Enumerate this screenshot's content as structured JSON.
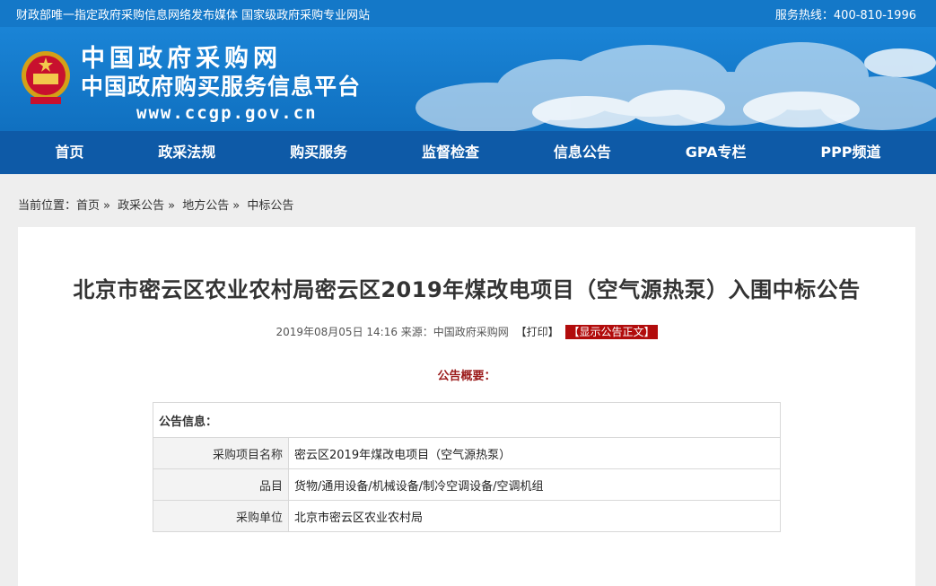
{
  "topbar": {
    "left_text": "财政部唯一指定政府采购信息网络发布媒体 国家级政府采购专业网站",
    "hotline_label": "服务热线：",
    "hotline": "400-810-1996"
  },
  "header": {
    "site_name": "中国政府采购网",
    "site_subtitle": "中国政府购买服务信息平台",
    "url": "www.ccgp.gov.cn"
  },
  "nav": {
    "items": [
      "首页",
      "政采法规",
      "购买服务",
      "监督检查",
      "信息公告",
      "GPA专栏",
      "PPP频道"
    ]
  },
  "breadcrumb": {
    "label": "当前位置：",
    "items": [
      "首页",
      "政采公告",
      "地方公告",
      "中标公告"
    ]
  },
  "article": {
    "title": "北京市密云区农业农村局密云区2019年煤改电项目（空气源热泵）入围中标公告",
    "datetime": "2019年08月05日 14:16",
    "source": "来源：中国政府采购网",
    "print_label": "【打印】",
    "show_label": "【显示公告正文】",
    "summary_label": "公告概要："
  },
  "info_table": {
    "header": "公告信息：",
    "rows": [
      {
        "label": "采购项目名称",
        "value": "密云区2019年煤改电项目（空气源热泵）"
      },
      {
        "label": "品目",
        "value": "货物/通用设备/机械设备/制冷空调设备/空调机组"
      },
      {
        "label": "采购单位",
        "value": "北京市密云区农业农村局"
      }
    ]
  },
  "colors": {
    "topbar": "#1478c8",
    "nav": "#0e5aa7",
    "accent_red": "#b20c0c"
  }
}
